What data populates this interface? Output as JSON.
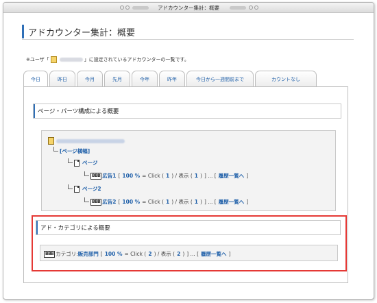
{
  "window": {
    "title": "アドカウンター集計：概要"
  },
  "page": {
    "title": "アドカウンター集計：概要",
    "note_prefix": "※ユーザ「",
    "note_suffix": "」に設定されているアドカウンターの一覧です。"
  },
  "tabs": [
    {
      "label": "今日",
      "active": true
    },
    {
      "label": "昨日"
    },
    {
      "label": "今月"
    },
    {
      "label": "先月"
    },
    {
      "label": "今年"
    },
    {
      "label": "昨年"
    },
    {
      "label": "今日から一週間前まで"
    },
    {
      "label": "カウントなし"
    }
  ],
  "section_page": {
    "heading": "ページ・パーツ構成による概要",
    "parts_label": "[ページ横幅]",
    "pages": [
      {
        "name": "ページ",
        "ad_name": "広告1",
        "percent": "100 %",
        "click": "1",
        "view": "1",
        "history": "履歴一覧へ"
      },
      {
        "name": "ページ2",
        "ad_name": "広告2",
        "percent": "100 %",
        "click": "1",
        "view": "1",
        "history": "履歴一覧へ"
      }
    ]
  },
  "section_category": {
    "heading": "アド・カテゴリによる概要",
    "category_prefix": "カテゴリ:",
    "category_name": "販売部門",
    "percent": "100 %",
    "click": "2",
    "view": "2",
    "history": "履歴一覧へ"
  },
  "labels": {
    "ad_badge": "BBB",
    "bracket_open": "[",
    "bracket_close": "]",
    "equals_click": "= Click (",
    "view_sep": ") / 表示 (",
    "close_paren": ")",
    "history_lead": "] ... [",
    "history_close": "]"
  },
  "colors": {
    "accent": "#2f6fb7",
    "link": "#1d5ea8",
    "highlight_border": "#e53935"
  }
}
